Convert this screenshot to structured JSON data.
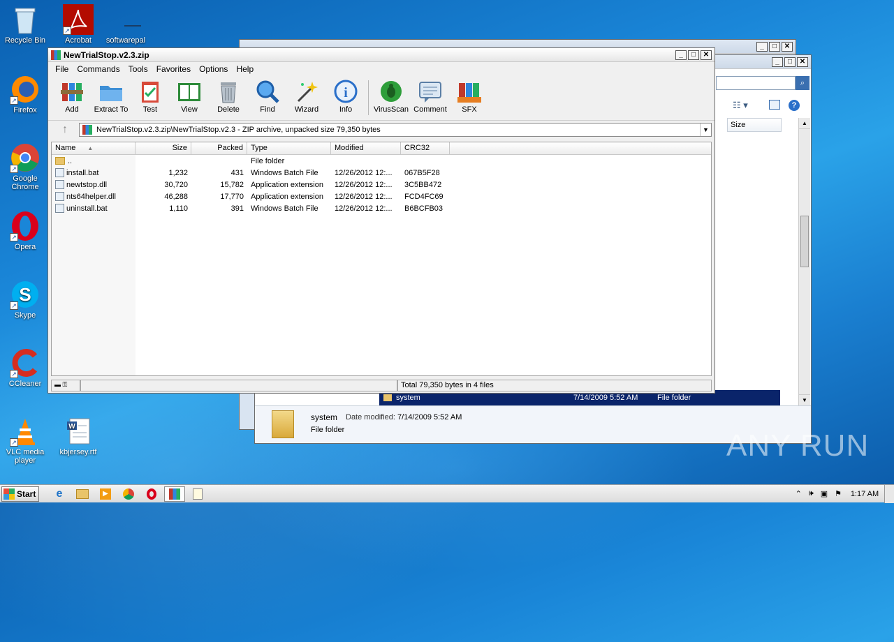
{
  "desktop": {
    "icons": [
      {
        "label": "Recycle Bin"
      },
      {
        "label": "Acrobat"
      },
      {
        "label": "softwarepal"
      },
      {
        "label": "Firefox"
      },
      {
        "label": "Google Chrome"
      },
      {
        "label": "Opera"
      },
      {
        "label": "Skype"
      },
      {
        "label": "CCleaner"
      },
      {
        "label": "VLC media player"
      },
      {
        "label": "kbjersey.rtf"
      }
    ]
  },
  "explorer": {
    "size_header": "Size",
    "selected_row": {
      "name": "system",
      "date": "7/14/2009 5:52 AM",
      "type": "File folder"
    },
    "details": {
      "name": "system",
      "date_label": "Date modified:",
      "date_value": "7/14/2009 5:52 AM",
      "type": "File folder"
    }
  },
  "winrar": {
    "title": "NewTrialStop.v2.3.zip",
    "menu": [
      "File",
      "Commands",
      "Tools",
      "Favorites",
      "Options",
      "Help"
    ],
    "toolbar": [
      {
        "label": "Add",
        "icon": "add-icon"
      },
      {
        "label": "Extract To",
        "icon": "extract-folder-icon"
      },
      {
        "label": "Test",
        "icon": "test-clipboard-icon"
      },
      {
        "label": "View",
        "icon": "view-book-icon"
      },
      {
        "label": "Delete",
        "icon": "trash-icon"
      },
      {
        "label": "Find",
        "icon": "magnifier-icon"
      },
      {
        "label": "Wizard",
        "icon": "wand-icon"
      },
      {
        "label": "Info",
        "icon": "info-icon"
      },
      {
        "label": "VirusScan",
        "icon": "bug-icon"
      },
      {
        "label": "Comment",
        "icon": "comment-icon"
      },
      {
        "label": "SFX",
        "icon": "sfx-icon"
      }
    ],
    "address": "NewTrialStop.v2.3.zip\\NewTrialStop.v2.3 - ZIP archive, unpacked size 79,350 bytes",
    "columns": [
      "Name",
      "Size",
      "Packed",
      "Type",
      "Modified",
      "CRC32"
    ],
    "files": [
      {
        "name": "..",
        "size": "",
        "packed": "",
        "type": "File folder",
        "modified": "",
        "crc": ""
      },
      {
        "name": "install.bat",
        "size": "1,232",
        "packed": "431",
        "type": "Windows Batch File",
        "modified": "12/26/2012 12:...",
        "crc": "067B5F28"
      },
      {
        "name": "newtstop.dll",
        "size": "30,720",
        "packed": "15,782",
        "type": "Application extension",
        "modified": "12/26/2012 12:...",
        "crc": "3C5BB472"
      },
      {
        "name": "nts64helper.dll",
        "size": "46,288",
        "packed": "17,770",
        "type": "Application extension",
        "modified": "12/26/2012 12:...",
        "crc": "FCD4FC69"
      },
      {
        "name": "uninstall.bat",
        "size": "1,110",
        "packed": "391",
        "type": "Windows Batch File",
        "modified": "12/26/2012 12:...",
        "crc": "B6BCFB03"
      }
    ],
    "status": "Total 79,350 bytes in 4 files"
  },
  "taskbar": {
    "start": "Start",
    "clock": "1:17 AM"
  },
  "watermark": "ANY RUN",
  "colors": {
    "selection": "#0a246a",
    "desktop": "#1a86d8"
  }
}
